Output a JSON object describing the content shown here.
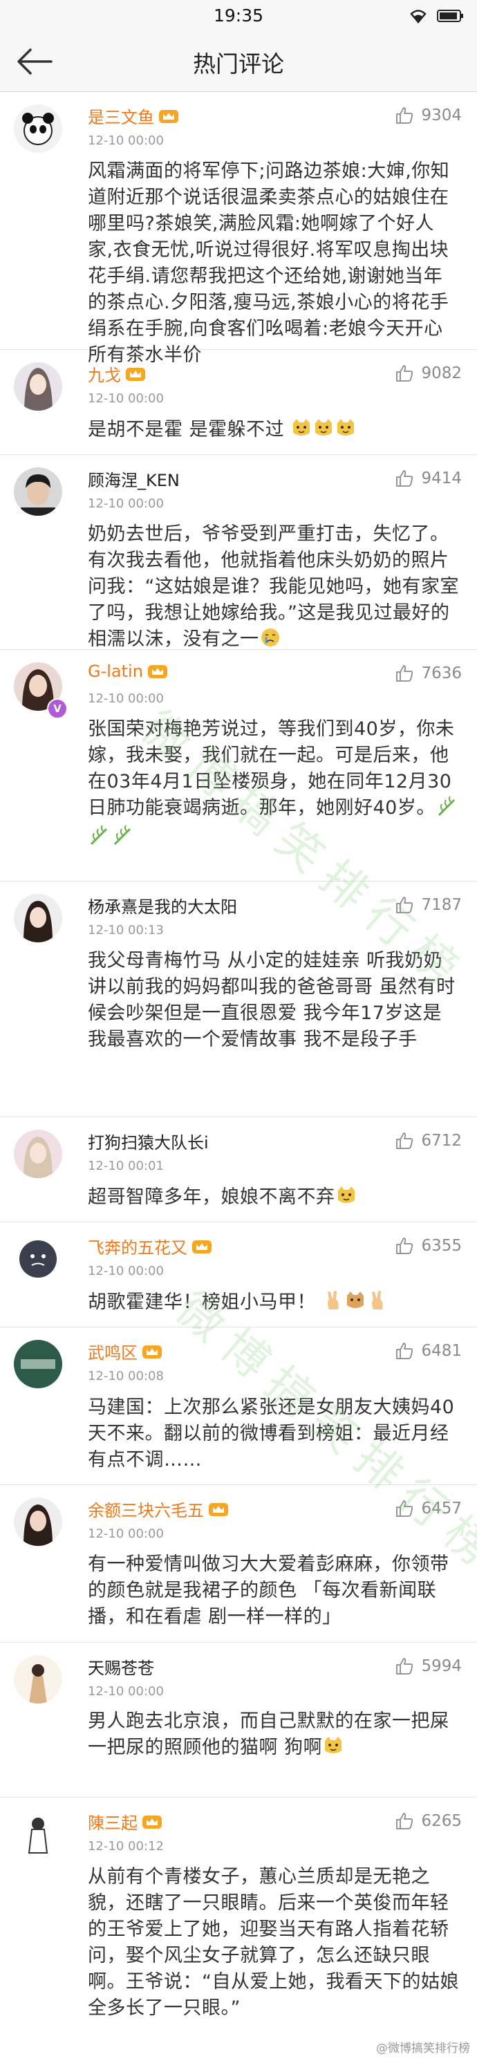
{
  "status_bar": {
    "time": "19:35"
  },
  "nav": {
    "title": "热门评论"
  },
  "comments": [
    {
      "user": "是三文鱼",
      "vip": true,
      "time": "12-10 00:00",
      "likes": "9304",
      "text": "风霜满面的将军停下;问路边茶娘:大婶,你知道附近那个说话很温柔卖茶点心的姑娘住在哪里吗?茶娘笑,满脸风霜:她啊嫁了个好人家,衣食无忧,听说过得很好.将军叹息掏出块花手绢.请您帮我把这个还给她,谢谢她当年的茶点心.夕阳落,瘦马远,茶娘小心的将花手绢系在手腕,向食客们吆喝着:老娘今天开心所有茶水半价"
    },
    {
      "user": "九戈",
      "vip": true,
      "time": "12-10 00:00",
      "likes": "9082",
      "text": "是胡不是霍 是霍躲不过"
    },
    {
      "user": "顾海涅_KEN",
      "vip": false,
      "time": "12-10 00:00",
      "likes": "9414",
      "text": "奶奶去世后，爷爷受到严重打击，失忆了。有次我去看他，他就指着他床头奶奶的照片问我：“这姑娘是谁？我能见她吗，她有家室了吗，我想让她嫁给我。”这是我见过最好的相濡以沫，没有之一"
    },
    {
      "user": "G-latin",
      "vip": true,
      "time": "12-10 00:00",
      "likes": "7636",
      "text": "张国荣对梅艳芳说过，等我们到40岁，你未嫁，我未娶，我们就在一起。可是后来，他在03年4月1日坠楼殒身，她在同年12月30日肺功能衰竭病逝。那年，她刚好40岁。"
    },
    {
      "user": "杨承熹是我的大太阳",
      "vip": false,
      "time": "12-10 00:13",
      "likes": "7187",
      "text": "我父母青梅竹马 从小定的娃娃亲 听我奶奶讲以前我的妈妈都叫我的爸爸哥哥 虽然有时候会吵架但是一直很恩爱 我今年17岁这是我最喜欢的一个爱情故事 我不是段子手"
    },
    {
      "user": "打狗扫猿大队长i",
      "vip": false,
      "time": "12-10 00:01",
      "likes": "6712",
      "text": "超哥智障多年，娘娘不离不弃"
    },
    {
      "user": "飞奔的五花又",
      "vip": true,
      "time": "12-10 00:00",
      "likes": "6355",
      "text": "胡歌霍建华！榜姐小马甲！"
    },
    {
      "user": "武鸣区",
      "vip": true,
      "time": "12-10 00:08",
      "likes": "6481",
      "text": "马建国：上次那么紧张还是女朋友大姨妈40天不来。翻以前的微博看到榜姐：最近月经有点不调……"
    },
    {
      "user": "余额三块六毛五",
      "vip": true,
      "time": "12-10 00:00",
      "likes": "6457",
      "text": "有一种爱情叫做习大大爱着彭麻麻，你领带的颜色就是我裙子的颜色 「每次看新闻联播，和在看虐 剧一样一样的」"
    },
    {
      "user": "天赐苍苍",
      "vip": false,
      "time": "12-10 00:00",
      "likes": "5994",
      "text": "男人跑去北京浪，而自己默默的在家一把屎一把尿的照顾他的猫啊 狗啊"
    },
    {
      "user": "陳三起",
      "vip": true,
      "time": "12-10 00:12",
      "likes": "6265",
      "text": "从前有个青楼女子，蕙心兰质却是无艳之貌，还瞎了一只眼睛。后来一个英俊而年轻的王爷爱上了她，迎娶当天有路人指着花轿问，娶个风尘女子就算了，怎么还缺只眼啊。王爷说：“自从爱上她，我看天下的姑娘全多长了一只眼。”"
    }
  ],
  "watermark": {
    "text": "微博搞笑排行榜"
  },
  "footer": {
    "mark": "@微博搞笑排行榜"
  },
  "colors": {
    "vip_name": "#f07a1b",
    "like_icon": "#8a8a8a",
    "heart": "#e8322f",
    "emoji": "#f5b731"
  }
}
